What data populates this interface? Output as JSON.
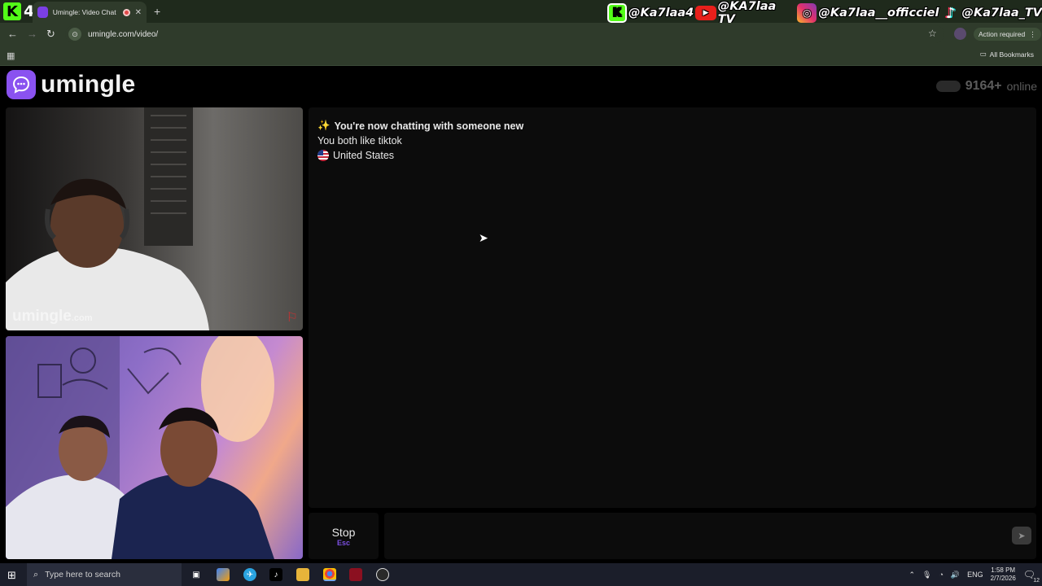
{
  "browser": {
    "tab_title": "Umingle: Video Chat with S",
    "url": "umingle.com/video/",
    "action_required": "Action required",
    "bookmarks_label": "All Bookmarks"
  },
  "stream_overlay": {
    "badge_number": "4",
    "socials": [
      {
        "icon": "kick-icon",
        "glyph": "K",
        "handle": "@Ka7laa4"
      },
      {
        "icon": "youtube-icon",
        "glyph": "▶",
        "handle": "@KA7laa TV"
      },
      {
        "icon": "instagram-icon",
        "glyph": "◎",
        "handle": "@Ka7laa__officciel"
      },
      {
        "icon": "tiktok-icon",
        "glyph": "♪",
        "handle": "@Ka7laa_TV"
      }
    ]
  },
  "site": {
    "logo_text": "umingle",
    "online_count": "9164+",
    "online_label": "online",
    "watermark": "umingle",
    "watermark_suffix": ".com"
  },
  "chat": {
    "status_emoji": "✨",
    "status_line": "You're now chatting with someone new",
    "interest_line": "You both like tiktok",
    "country": "United States"
  },
  "controls": {
    "stop_label": "Stop",
    "stop_key": "Esc",
    "send_glyph": "➤"
  },
  "taskbar": {
    "search_placeholder": "Type here to search",
    "language": "ENG",
    "time": "1:58 PM",
    "date": "2/7/2026",
    "notification_count": "12"
  },
  "colors": {
    "brand": "#8a52f0",
    "browser_frame": "#2f3b2b",
    "kick_green": "#53fc18"
  }
}
